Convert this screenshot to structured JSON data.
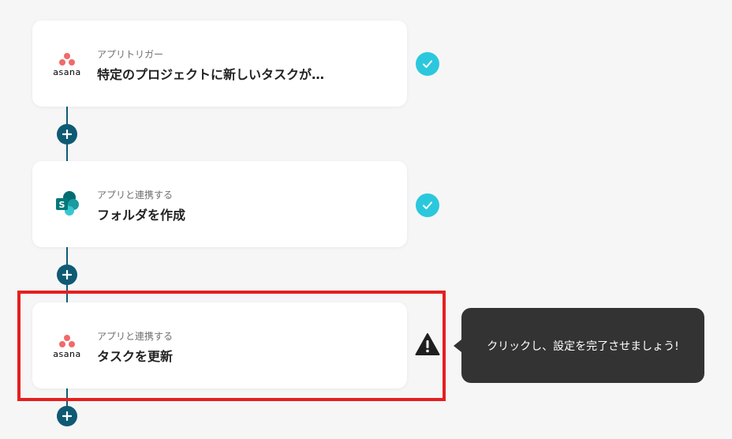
{
  "steps": [
    {
      "app": "asana",
      "logo_text": "asana",
      "subtitle": "アプリトリガー",
      "title": "特定のプロジェクトに新しいタスクが…",
      "status": "complete"
    },
    {
      "app": "sharepoint",
      "logo_letter": "S",
      "subtitle": "アプリと連携する",
      "title": "フォルダを作成",
      "status": "complete"
    },
    {
      "app": "asana",
      "logo_text": "asana",
      "subtitle": "アプリと連携する",
      "title": "タスクを更新",
      "status": "warning"
    }
  ],
  "tooltip": {
    "text": "クリックし、設定を完了させましょう!"
  },
  "colors": {
    "connector": "#0f5a73",
    "check": "#2bc8dd",
    "highlight": "#e51f1f",
    "tooltip_bg": "#333333",
    "asana_dots": "#f06a6a",
    "sharepoint": "#038387"
  },
  "icons": {
    "add": "plus-icon",
    "complete": "check-icon",
    "warning": "warning-triangle-icon"
  }
}
